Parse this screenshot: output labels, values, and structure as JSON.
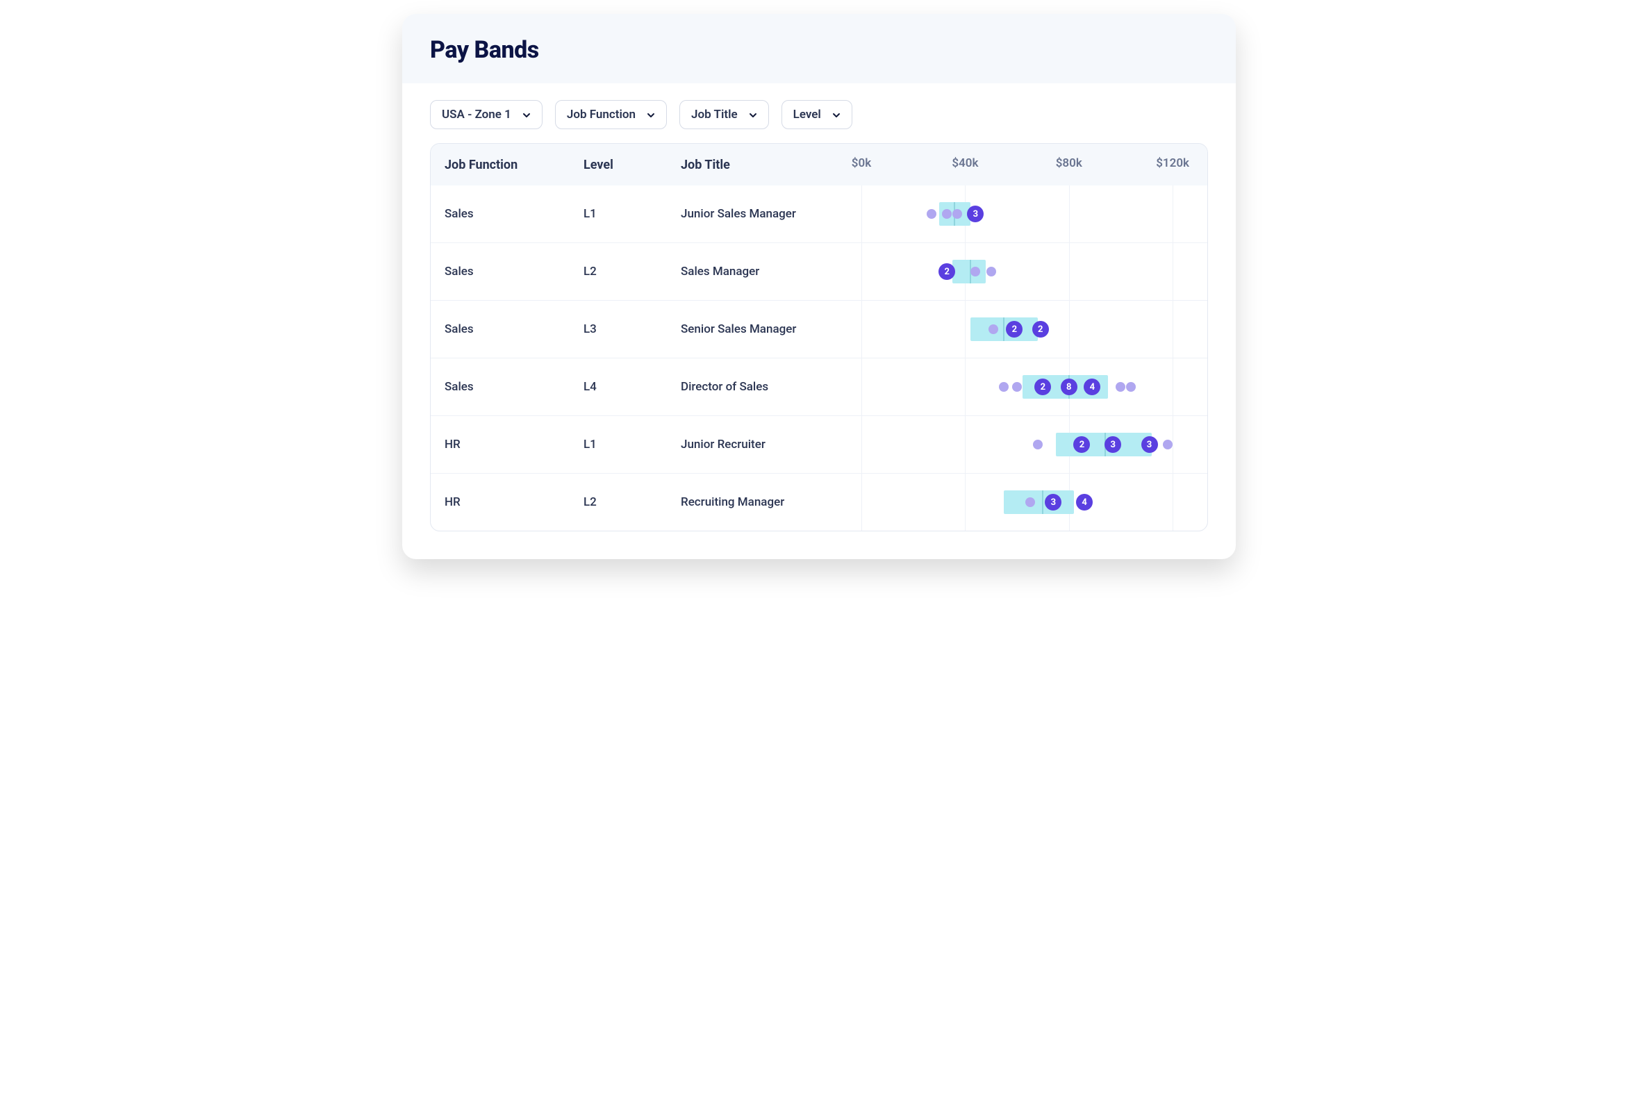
{
  "header": {
    "title": "Pay Bands"
  },
  "filters": [
    {
      "label": "USA - Zone 1"
    },
    {
      "label": "Job Function"
    },
    {
      "label": "Job Title"
    },
    {
      "label": "Level"
    }
  ],
  "columns": {
    "function": "Job Function",
    "level": "Level",
    "title": "Job Title"
  },
  "axis": {
    "ticks": [
      {
        "value": 0,
        "label": "$0k"
      },
      {
        "value": 40,
        "label": "$40k"
      },
      {
        "value": 80,
        "label": "$80k"
      },
      {
        "value": 120,
        "label": "$120k"
      }
    ],
    "min": 0,
    "max": 128
  },
  "rows": [
    {
      "function": "Sales",
      "level": "L1",
      "title": "Junior Sales Manager"
    },
    {
      "function": "Sales",
      "level": "L2",
      "title": "Sales Manager"
    },
    {
      "function": "Sales",
      "level": "L3",
      "title": "Senior Sales Manager"
    },
    {
      "function": "Sales",
      "level": "L4",
      "title": "Director of Sales"
    },
    {
      "function": "HR",
      "level": "L1",
      "title": "Junior Recruiter"
    },
    {
      "function": "HR",
      "level": "L2",
      "title": "Recruiting Manager"
    }
  ],
  "chart_data": {
    "type": "bar",
    "title": "Pay Bands",
    "xlabel": "",
    "ylabel": "",
    "xlim": [
      0,
      128
    ],
    "x_ticks": [
      0,
      40,
      80,
      120
    ],
    "x_tick_labels": [
      "$0k",
      "$40k",
      "$80k",
      "$120k"
    ],
    "series": [
      {
        "job_function": "Sales",
        "level": "L1",
        "job_title": "Junior Sales Manager",
        "band": {
          "low": 30,
          "mid": 36,
          "high": 42
        },
        "points": [
          {
            "value": 27,
            "count": 1
          },
          {
            "value": 33,
            "count": 1
          },
          {
            "value": 37,
            "count": 1
          },
          {
            "value": 44,
            "count": 3
          }
        ]
      },
      {
        "job_function": "Sales",
        "level": "L2",
        "job_title": "Sales Manager",
        "band": {
          "low": 35,
          "mid": 42,
          "high": 48
        },
        "points": [
          {
            "value": 33,
            "count": 2
          },
          {
            "value": 44,
            "count": 1
          },
          {
            "value": 50,
            "count": 1
          }
        ]
      },
      {
        "job_function": "Sales",
        "level": "L3",
        "job_title": "Senior Sales Manager",
        "band": {
          "low": 42,
          "mid": 55,
          "high": 68
        },
        "points": [
          {
            "value": 51,
            "count": 1
          },
          {
            "value": 59,
            "count": 2
          },
          {
            "value": 69,
            "count": 2
          }
        ]
      },
      {
        "job_function": "Sales",
        "level": "L4",
        "job_title": "Director of Sales",
        "band": {
          "low": 62,
          "mid": 80,
          "high": 95
        },
        "points": [
          {
            "value": 55,
            "count": 1
          },
          {
            "value": 60,
            "count": 1
          },
          {
            "value": 70,
            "count": 2
          },
          {
            "value": 80,
            "count": 8
          },
          {
            "value": 89,
            "count": 4
          },
          {
            "value": 100,
            "count": 1
          },
          {
            "value": 104,
            "count": 1
          }
        ]
      },
      {
        "job_function": "HR",
        "level": "L1",
        "job_title": "Junior Recruiter",
        "band": {
          "low": 75,
          "mid": 94,
          "high": 112
        },
        "points": [
          {
            "value": 68,
            "count": 1
          },
          {
            "value": 85,
            "count": 2
          },
          {
            "value": 97,
            "count": 3
          },
          {
            "value": 111,
            "count": 3
          },
          {
            "value": 118,
            "count": 1
          }
        ]
      },
      {
        "job_function": "HR",
        "level": "L2",
        "job_title": "Recruiting Manager",
        "band": {
          "low": 55,
          "mid": 70,
          "high": 82
        },
        "points": [
          {
            "value": 65,
            "count": 1
          },
          {
            "value": 74,
            "count": 3
          },
          {
            "value": 86,
            "count": 4
          }
        ]
      }
    ]
  }
}
